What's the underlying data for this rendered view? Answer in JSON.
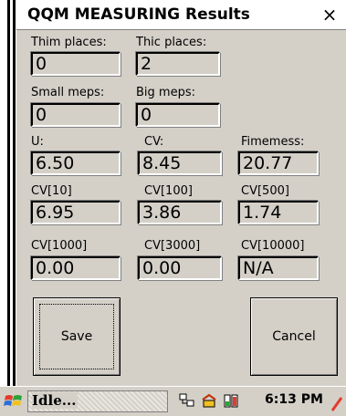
{
  "window": {
    "title": "QQM MEASURING Results",
    "close_glyph": "×"
  },
  "fields": {
    "thin_places": {
      "label": "Thim places:",
      "value": "0"
    },
    "thick_places": {
      "label": "Thic places:",
      "value": "2"
    },
    "small_neps": {
      "label": "Small meps:",
      "value": "0"
    },
    "big_neps": {
      "label": "Big meps:",
      "value": "0"
    },
    "u": {
      "label": "U:",
      "value": "6.50"
    },
    "cv": {
      "label": "CV:",
      "value": "8.45"
    },
    "fineness": {
      "label": "Fimemess:",
      "value": "20.77"
    },
    "cv10": {
      "label": "CV[10]",
      "value": "6.95"
    },
    "cv100": {
      "label": "CV[100]",
      "value": "3.86"
    },
    "cv500": {
      "label": "CV[500]",
      "value": "1.74"
    },
    "cv1000": {
      "label": "CV[1000]",
      "value": "0.00"
    },
    "cv3000": {
      "label": "CV[3000]",
      "value": "0.00"
    },
    "cv10000": {
      "label": "CV[10000]",
      "value": "N/A"
    }
  },
  "buttons": {
    "save": "Save",
    "cancel": "Cancel"
  },
  "taskbar": {
    "status": "Idle...",
    "time": "6:13 PM"
  },
  "icons": {
    "start": "windows-flag-icon",
    "network": "network-icon",
    "battery": "battery-icon",
    "sync": "sync-icon"
  }
}
